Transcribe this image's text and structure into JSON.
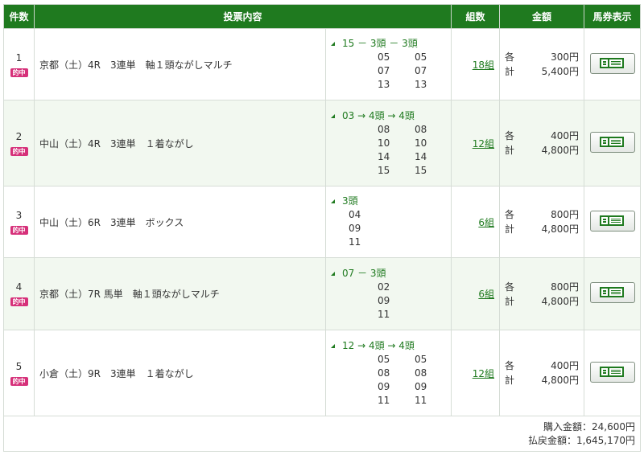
{
  "header": {
    "count": "件数",
    "content": "投票内容",
    "combos": "組数",
    "amount": "金額",
    "ticket": "馬券表示"
  },
  "hit_label": "的中",
  "amount_labels": {
    "each": "各",
    "total": "計"
  },
  "rows": [
    {
      "index": "1",
      "content": "京都（土）4R　3連単　軸１頭ながしマルチ",
      "combo_header": "15 － 3頭 － 3頭",
      "numbers": [
        [
          "05",
          "05"
        ],
        [
          "07",
          "07"
        ],
        [
          "13",
          "13"
        ]
      ],
      "combos": "18組",
      "each": "300円",
      "total": "5,400円"
    },
    {
      "index": "2",
      "content": "中山（土）4R　3連単　１着ながし",
      "combo_header": "03 → 4頭 → 4頭",
      "numbers": [
        [
          "08",
          "08"
        ],
        [
          "10",
          "10"
        ],
        [
          "14",
          "14"
        ],
        [
          "15",
          "15"
        ]
      ],
      "combos": "12組",
      "each": "400円",
      "total": "4,800円"
    },
    {
      "index": "3",
      "content": "中山（土）6R　3連単　ボックス",
      "combo_header": "3頭",
      "numbers": [
        [
          "04"
        ],
        [
          "09"
        ],
        [
          "11"
        ]
      ],
      "combos": "6組",
      "each": "800円",
      "total": "4,800円"
    },
    {
      "index": "4",
      "content": "京都（土）7R 馬単　軸１頭ながしマルチ",
      "combo_header": "07 － 3頭",
      "numbers": [
        [
          "02"
        ],
        [
          "09"
        ],
        [
          "11"
        ]
      ],
      "combos": "6組",
      "each": "800円",
      "total": "4,800円"
    },
    {
      "index": "5",
      "content": "小倉（土）9R　3連単　１着ながし",
      "combo_header": "12 → 4頭 → 4頭",
      "numbers": [
        [
          "05",
          "05"
        ],
        [
          "08",
          "08"
        ],
        [
          "09",
          "09"
        ],
        [
          "11",
          "11"
        ]
      ],
      "combos": "12組",
      "each": "400円",
      "total": "4,800円"
    }
  ],
  "summary": {
    "purchase": "購入金額：24,600円",
    "payout": "払戻金額：1,645,170円"
  },
  "colors": {
    "header_bg": "#1f7a1f",
    "hit_badge": "#d6317a",
    "alt_row": "#f2f8f0"
  },
  "icons": {
    "ticket": "ticket-view-icon",
    "combo_marker": "triangle-icon"
  }
}
